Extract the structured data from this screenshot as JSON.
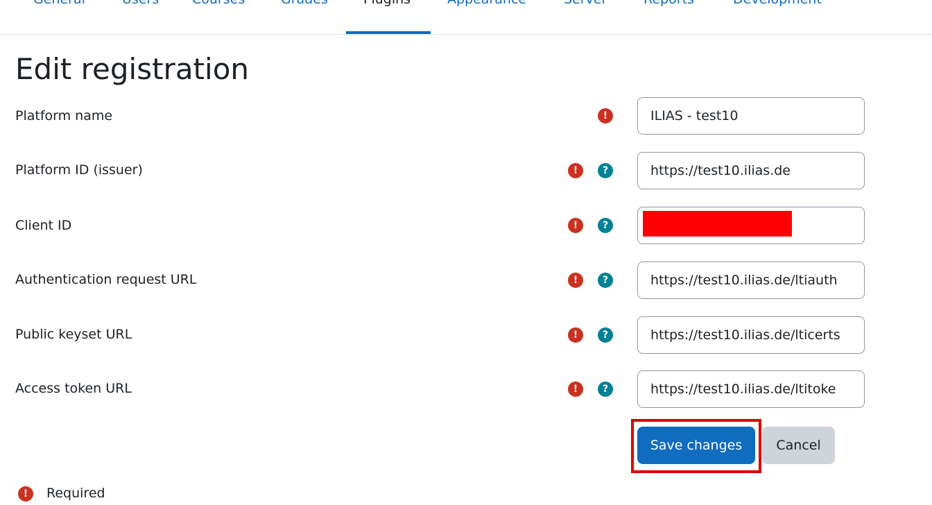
{
  "tabs": [
    {
      "label": "General",
      "active": false
    },
    {
      "label": "Users",
      "active": false
    },
    {
      "label": "Courses",
      "active": false
    },
    {
      "label": "Grades",
      "active": false
    },
    {
      "label": "Plugins",
      "active": true
    },
    {
      "label": "Appearance",
      "active": false
    },
    {
      "label": "Server",
      "active": false
    },
    {
      "label": "Reports",
      "active": false
    },
    {
      "label": "Development",
      "active": false
    }
  ],
  "page": {
    "title": "Edit registration"
  },
  "form": {
    "fields": [
      {
        "label": "Platform name",
        "value": "ILIAS - test10",
        "required": true,
        "has_help": false
      },
      {
        "label": "Platform ID (issuer)",
        "value": "https://test10.ilias.de",
        "required": true,
        "has_help": true
      },
      {
        "label": "Client ID",
        "value": "",
        "required": true,
        "has_help": true,
        "redacted": true
      },
      {
        "label": "Authentication request URL",
        "value": "https://test10.ilias.de/ltiauth",
        "required": true,
        "has_help": true
      },
      {
        "label": "Public keyset URL",
        "value": "https://test10.ilias.de/lticerts",
        "required": true,
        "has_help": true
      },
      {
        "label": "Access token URL",
        "value": "https://test10.ilias.de/ltitoke",
        "required": true,
        "has_help": true
      }
    ],
    "save_label": "Save changes",
    "cancel_label": "Cancel",
    "required_legend": "Required"
  },
  "icons": {
    "required": "exclamation-circle-icon",
    "help": "question-circle-icon"
  },
  "colors": {
    "link": "#0f6cbf",
    "primary": "#0f6cbf",
    "required": "#ca3120",
    "help": "#008196",
    "annotation": "#e00000"
  }
}
